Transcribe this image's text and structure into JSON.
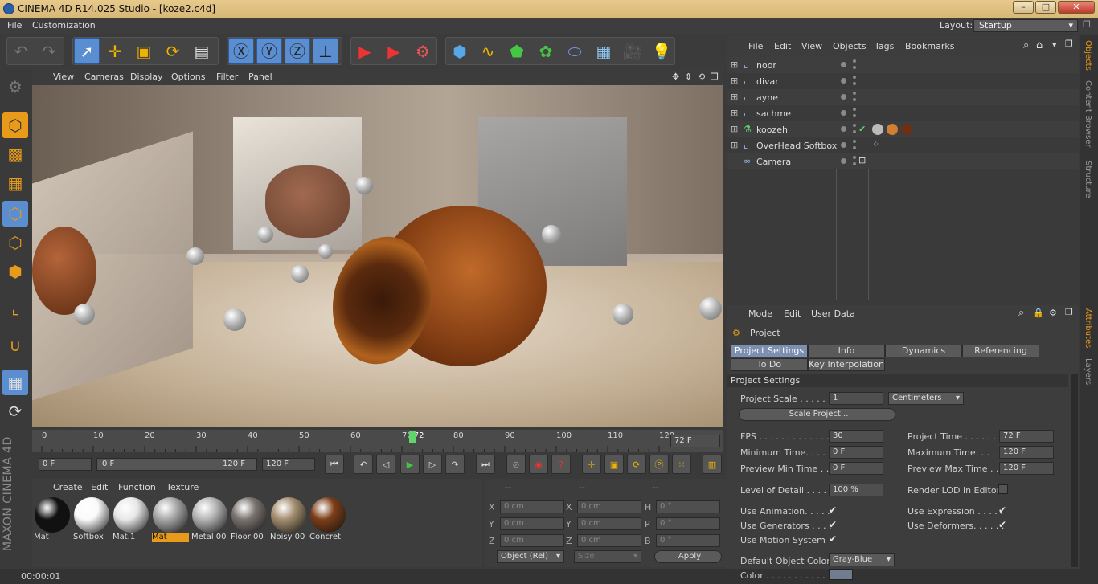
{
  "window": {
    "title": "CINEMA 4D R14.025 Studio - [koze2.c4d]"
  },
  "menu": {
    "items": [
      "File",
      "Customization"
    ],
    "layout_label": "Layout:",
    "layout_value": "Startup"
  },
  "viewport": {
    "menu": [
      "View",
      "Cameras",
      "Display",
      "Options",
      "Filter",
      "Panel"
    ]
  },
  "timeline": {
    "ticks": [
      "0",
      "10",
      "20",
      "30",
      "40",
      "50",
      "60",
      "70",
      "72",
      "80",
      "90",
      "100",
      "110",
      "120"
    ],
    "current_frame": "72",
    "current_field": "72 F",
    "start_field": "0 F",
    "range_start": "0 F",
    "range_end": "120 F",
    "end_field": "120 F"
  },
  "materials": {
    "menu": [
      "Create",
      "Edit",
      "Function",
      "Texture"
    ],
    "items": [
      {
        "name": "Mat",
        "color": "#111"
      },
      {
        "name": "Softbox",
        "color": "#fafafa"
      },
      {
        "name": "Mat.1",
        "color": "#e8e8e8"
      },
      {
        "name": "Mat",
        "color": "#a8a8a8",
        "selected": true
      },
      {
        "name": "Metal 00",
        "color": "#b5b5b5"
      },
      {
        "name": "Floor 00",
        "color": "#7a7370"
      },
      {
        "name": "Noisy 00",
        "color": "#a48e70"
      },
      {
        "name": "Concret",
        "color": "#7c3e18"
      }
    ]
  },
  "coords": {
    "headers": [
      "--",
      "--",
      "--"
    ],
    "rows": [
      [
        "X",
        "0 cm",
        "X",
        "0 cm",
        "H",
        "0 °"
      ],
      [
        "Y",
        "0 cm",
        "Y",
        "0 cm",
        "P",
        "0 °"
      ],
      [
        "Z",
        "0 cm",
        "Z",
        "0 cm",
        "B",
        "0 °"
      ]
    ],
    "mode": "Object (Rel)",
    "size": "Size",
    "apply": "Apply"
  },
  "status": {
    "time": "00:00:01"
  },
  "objects": {
    "menu": [
      "File",
      "Edit",
      "View",
      "Objects",
      "Tags",
      "Bookmarks"
    ],
    "rows": [
      "noor",
      "divar",
      "ayne",
      "sachme",
      "koozeh",
      "OverHead Softbox",
      "Camera"
    ]
  },
  "attributes": {
    "menu": [
      "Mode",
      "Edit",
      "User Data"
    ],
    "title": "Project",
    "tabs": [
      "Project Settings",
      "Info",
      "Dynamics",
      "Referencing",
      "To Do",
      "Key Interpolation"
    ],
    "section": "Project Settings",
    "project_scale_label": "Project Scale . . . . . .",
    "project_scale": "1",
    "scale_unit": "Centimeters",
    "scale_project_btn": "Scale Project...",
    "fps_label": "FPS . . . . . . . . . . . . . . .",
    "fps": "30",
    "project_time_label": "Project Time . . . . . . . .",
    "project_time": "72 F",
    "min_time_label": "Minimum Time. . . . .",
    "min_time": "0 F",
    "max_time_label": "Maximum Time. . . . . . .",
    "max_time": "120 F",
    "prev_min_label": "Preview Min Time . .",
    "prev_min": "0 F",
    "prev_max_label": "Preview Max Time . . .",
    "prev_max": "120 F",
    "lod_label": "Level of Detail . . . . .",
    "lod": "100 %",
    "render_lod_label": "Render LOD in Editor",
    "use_anim_label": "Use Animation. . . . .",
    "use_expr_label": "Use Expression . . . . .",
    "use_gen_label": "Use Generators . . . .",
    "use_def_label": "Use Deformers. . . . . .",
    "use_motion_label": "Use Motion System",
    "default_color_label": "Default Object Color",
    "default_color": "Gray-Blue",
    "color_label": "Color . . . . . . . . . . ."
  },
  "sidetabs": [
    "Objects",
    "Content Browser",
    "Structure",
    "Attributes",
    "Layers"
  ]
}
